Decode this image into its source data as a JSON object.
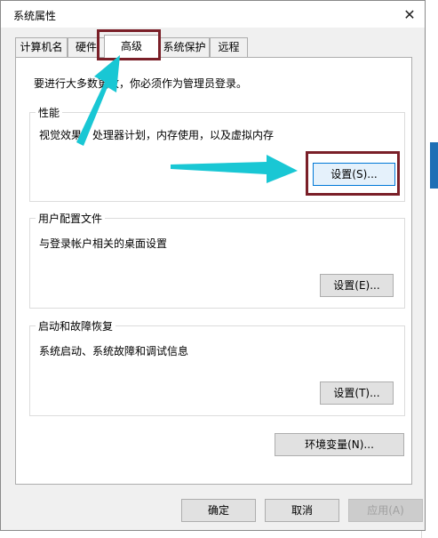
{
  "window": {
    "title": "系统属性",
    "close_glyph": "✕"
  },
  "tabs": [
    {
      "label": "计算机名"
    },
    {
      "label": "硬件"
    },
    {
      "label": "高级"
    },
    {
      "label": "系统保护"
    },
    {
      "label": "远程"
    }
  ],
  "active_tab": "高级",
  "notice": "要进行大多数更改，你必须作为管理员登录。",
  "performance": {
    "title": "性能",
    "description": "视觉效果，处理器计划，内存使用，以及虚拟内存",
    "button": "设置(S)..."
  },
  "user_profiles": {
    "title": "用户配置文件",
    "description": "与登录帐户相关的桌面设置",
    "button": "设置(E)..."
  },
  "startup_recovery": {
    "title": "启动和故障恢复",
    "description": "系统启动、系统故障和调试信息",
    "button": "设置(T)..."
  },
  "env_button": "环境变量(N)...",
  "footer": {
    "ok": "确定",
    "cancel": "取消",
    "apply": "应用(A)"
  },
  "annotation_color": "#7a1f28",
  "arrow_color": "#19c7d4"
}
